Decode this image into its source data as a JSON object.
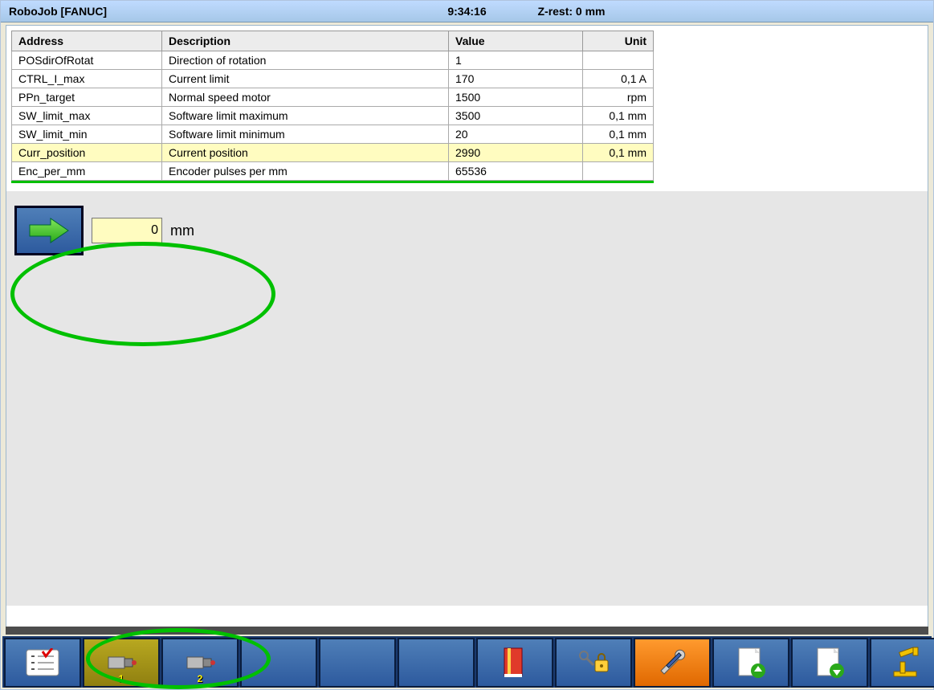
{
  "titlebar": {
    "app": "RoboJob [FANUC]",
    "time": "9:34:16",
    "zrest": "Z-rest: 0 mm"
  },
  "table": {
    "headers": {
      "c0": "Address",
      "c1": "Description",
      "c2": "Value",
      "c3": "Unit"
    },
    "rows": [
      {
        "addr": "POSdirOfRotat",
        "desc": "Direction of rotation",
        "val": "1",
        "unit": ""
      },
      {
        "addr": "CTRL_I_max",
        "desc": "Current limit",
        "val": "170",
        "unit": "0,1 A"
      },
      {
        "addr": "PPn_target",
        "desc": "Normal speed motor",
        "val": "1500",
        "unit": "rpm"
      },
      {
        "addr": "SW_limit_max",
        "desc": "Software limit maximum",
        "val": "3500",
        "unit": "0,1 mm"
      },
      {
        "addr": "SW_limit_min",
        "desc": "Software limit minimum",
        "val": "20",
        "unit": "0,1 mm"
      },
      {
        "addr": "Curr_position",
        "desc": "Current position",
        "val": "2990",
        "unit": "0,1 mm",
        "hl": true
      },
      {
        "addr": "Enc_per_mm",
        "desc": "Encoder pulses per mm",
        "val": "65536",
        "unit": ""
      }
    ]
  },
  "move": {
    "value": "0",
    "unit": "mm"
  },
  "toolbar": {
    "servo1_num": "1",
    "servo2_num": "2"
  }
}
